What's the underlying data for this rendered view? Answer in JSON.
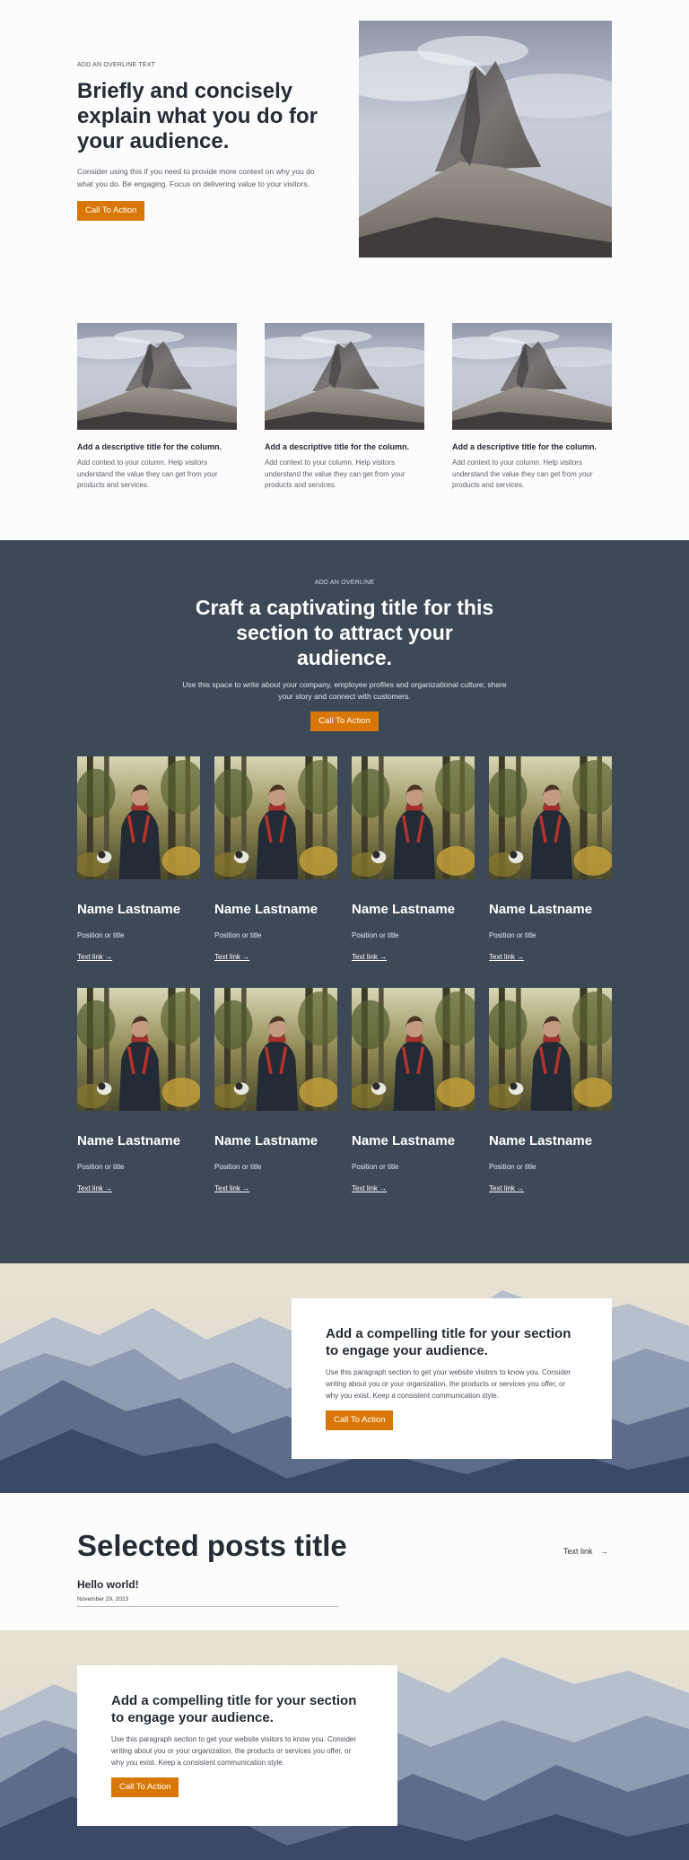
{
  "hero": {
    "overline": "ADD AN OVERLINE TEXT",
    "title": "Briefly and concisely explain what you do for your audience.",
    "body": "Consider using this if you need to provide more context on why you do what you do. Be engaging. Focus on delivering value to your visitors.",
    "cta": "Call To Action"
  },
  "columns": [
    {
      "title": "Add a descriptive title for the column.",
      "body": "Add context to your column. Help visitors understand the value they can get from your products and services."
    },
    {
      "title": "Add a descriptive title for the column.",
      "body": "Add context to your column. Help visitors understand the value they can get from your products and services."
    },
    {
      "title": "Add a descriptive title for the column.",
      "body": "Add context to your column. Help visitors understand the value they can get from your products and services."
    }
  ],
  "team": {
    "overline": "ADD AN OVERLINE",
    "title": "Craft a captivating title for this section to attract your audience.",
    "body": "Use this space to write about your company, employee profiles and organizational culture; share your story and connect with customers.",
    "cta": "Call To Action",
    "members": [
      {
        "name": "Name Lastname",
        "position": "Position or title",
        "link": "Text link →"
      },
      {
        "name": "Name Lastname",
        "position": "Position or title",
        "link": "Text link →"
      },
      {
        "name": "Name Lastname",
        "position": "Position or title",
        "link": "Text link →"
      },
      {
        "name": "Name Lastname",
        "position": "Position or title",
        "link": "Text link →"
      },
      {
        "name": "Name Lastname",
        "position": "Position or title",
        "link": "Text link →"
      },
      {
        "name": "Name Lastname",
        "position": "Position or title",
        "link": "Text link →"
      },
      {
        "name": "Name Lastname",
        "position": "Position or title",
        "link": "Text link →"
      },
      {
        "name": "Name Lastname",
        "position": "Position or title",
        "link": "Text link →"
      }
    ]
  },
  "cta_band_1": {
    "title": "Add a compelling title for your section to engage your audience.",
    "body": "Use this paragraph section to get your website visitors to know you. Consider writing about you or your organization, the products or services you offer, or why you exist. Keep a consistent communication style.",
    "cta": "Call To Action"
  },
  "posts": {
    "title": "Selected posts title",
    "text_link": "Text link",
    "items": [
      {
        "title": "Hello world!",
        "date": "November 29, 2023"
      }
    ]
  },
  "cta_band_2": {
    "title": "Add a compelling title for your section to engage your audience.",
    "body": "Use this paragraph section to get your website visitors to know you. Consider writing about you or your organization, the products or services you offer, or why you exist. Keep a consistent communication style.",
    "cta": "Call To Action"
  },
  "colors": {
    "accent": "#d97706",
    "team_bg": "#3e4957",
    "text": "#262c36"
  }
}
